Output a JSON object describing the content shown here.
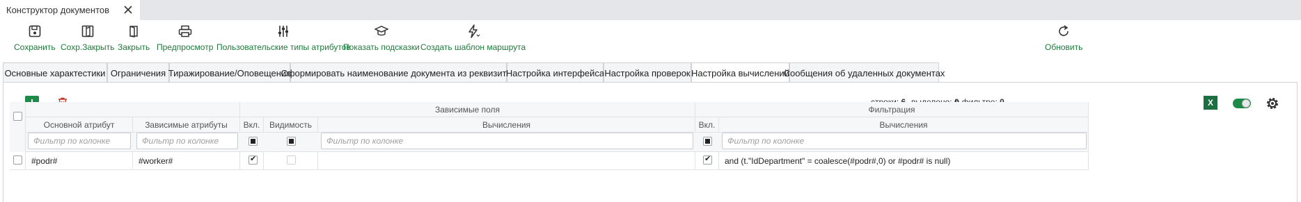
{
  "window": {
    "tab_title": "Конструктор документов"
  },
  "toolbar": {
    "save": "Сохранить",
    "save_close": "Сохр.Закрыть",
    "close": "Закрыть",
    "preview": "Предпросмотр",
    "custom_attr_types": "Пользовательские типы атрибутов",
    "show_hints": "Показать подсказки",
    "create_route_template": "Создать шаблон маршрута",
    "refresh": "Обновить",
    "accent_color": "#1e7a3c"
  },
  "tabs": [
    {
      "label": "Основные характестики"
    },
    {
      "label": "Ограничения"
    },
    {
      "label": "Тиражирование/Оповещения"
    },
    {
      "label": "Сформировать наименование документа из реквизитов"
    },
    {
      "label": "Настройка интерфейса"
    },
    {
      "label": "Настройка проверок"
    },
    {
      "label": "Настройка вычислений",
      "active": true
    },
    {
      "label": "Сообщения об удаленных документах"
    }
  ],
  "stats": {
    "rows_label": "строки:",
    "rows_value": "6",
    "selected_label": "выделено:",
    "selected_value": "0",
    "filtered_label": "в фильтре:",
    "filtered_value": "0"
  },
  "grid": {
    "group_dependent": "Зависимые поля",
    "group_filter": "Фильтрация",
    "col_main_attr": "Основной атрибут",
    "col_dep_attrs": "Зависимые атрибуты",
    "col_enabled": "Вкл.",
    "col_visibility": "Видимость",
    "col_calc": "Вычисления",
    "col_filter_enabled": "Вкл.",
    "col_filter_calc": "Вычисления",
    "filter_placeholder": "Фильтр по колонке",
    "rows": [
      {
        "main_attr": "#podr#",
        "dep_attrs": "#worker#",
        "enabled": true,
        "visibility": false,
        "calc": "",
        "filter_enabled": true,
        "filter_calc": "and (t.\"IdDepartment\" = coalesce(#podr#,0) or #podr# is null)"
      }
    ]
  }
}
